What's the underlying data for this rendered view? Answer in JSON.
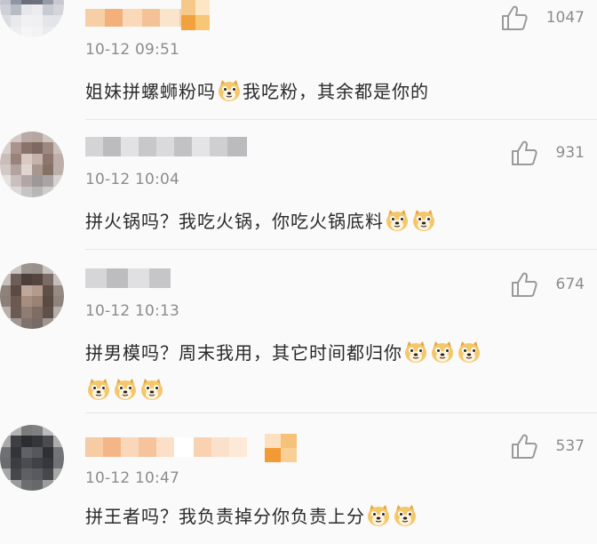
{
  "comments": [
    {
      "time": "10-12 09:51",
      "likes": "1047",
      "text": "姐妹拼螺蛳粉吗",
      "text2": "我吃粉，其余都是你的",
      "text_line2": ""
    },
    {
      "time": "10-12 10:04",
      "likes": "931",
      "text": "拼火锅吗？我吃火锅，你吃火锅底料",
      "text2": "",
      "text_line2": ""
    },
    {
      "time": "10-12 10:13",
      "likes": "674",
      "text": "拼男模吗？周末我用，其它时间都归你",
      "text2": "",
      "text_line2": ""
    },
    {
      "time": "10-12 10:47",
      "likes": "537",
      "text": "拼王者吗？我负责掉分你负责上分",
      "text2": "",
      "text_line2": ""
    }
  ],
  "icons": {
    "like": "thumbs-up-icon",
    "emoji": "doge-emoji-icon"
  },
  "colors": {
    "background": "#fafafa",
    "time": "#8c8c8c",
    "text": "#2a2a2a",
    "divider": "#e6e6e6",
    "accent": "#f5a340"
  }
}
